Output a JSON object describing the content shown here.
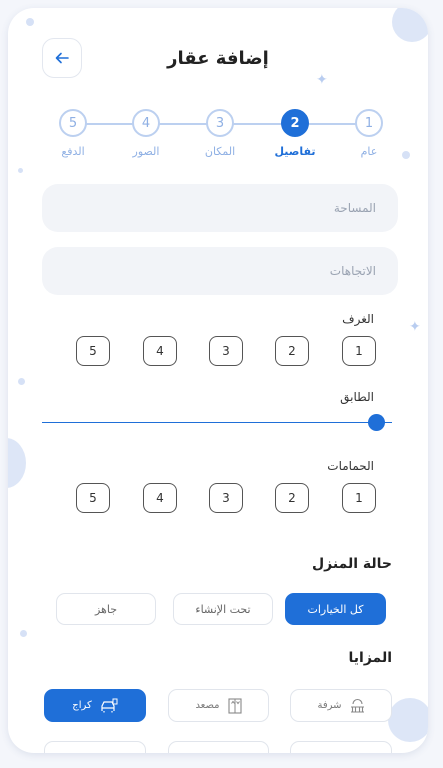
{
  "header": {
    "title": "إضافة عقار"
  },
  "stepper": {
    "steps": [
      {
        "number": "1",
        "label": "عام"
      },
      {
        "number": "2",
        "label": "تفاصيل"
      },
      {
        "number": "3",
        "label": "المكان"
      },
      {
        "number": "4",
        "label": "الصور"
      },
      {
        "number": "5",
        "label": "الدفع"
      }
    ],
    "active_step": 2
  },
  "form": {
    "area_placeholder": "المساحة",
    "directions_placeholder": "الاتجاهات",
    "rooms": {
      "label": "الغرف",
      "options": [
        "1",
        "2",
        "3",
        "4",
        "5"
      ]
    },
    "floor": {
      "label": "الطابق"
    },
    "bathrooms": {
      "label": "الحمامات",
      "options": [
        "1",
        "2",
        "3",
        "4",
        "5"
      ]
    }
  },
  "home_status": {
    "title": "حالة المنزل",
    "options": [
      "كل الخيارات",
      "تحت الإنشاء",
      "جاهز"
    ],
    "selected": "كل الخيارات"
  },
  "features": {
    "title": "المزايا",
    "items": [
      {
        "label": "شرفة",
        "icon": "balcony-icon",
        "selected": false
      },
      {
        "label": "مصعد",
        "icon": "elevator-icon",
        "selected": false
      },
      {
        "label": "كراج",
        "icon": "garage-icon",
        "selected": true
      }
    ]
  },
  "colors": {
    "accent": "#1f6fd8",
    "muted": "#8fb0e4",
    "field_bg": "#f2f4f8"
  }
}
